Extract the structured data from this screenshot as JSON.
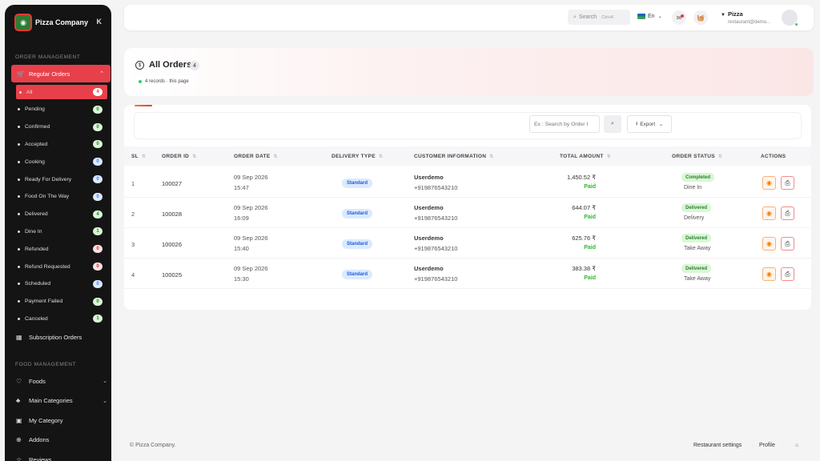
{
  "brand": {
    "name": "Pizza Company"
  },
  "sidebar": {
    "section_order": "ORDER MANAGEMENT",
    "regular_orders": "Regular Orders",
    "order_items": [
      {
        "label": "All",
        "count": "4",
        "color": "active"
      },
      {
        "label": "Pending",
        "count": "0",
        "color": "green"
      },
      {
        "label": "Confirmed",
        "count": "0",
        "color": "green"
      },
      {
        "label": "Accepted",
        "count": "0",
        "color": "green"
      },
      {
        "label": "Cooking",
        "count": "0",
        "color": "blue"
      },
      {
        "label": "Ready For Delivery",
        "count": "0",
        "color": "blue"
      },
      {
        "label": "Food On The Way",
        "count": "0",
        "color": "blue"
      },
      {
        "label": "Delivered",
        "count": "4",
        "color": "green"
      },
      {
        "label": "Dine In",
        "count": "1",
        "color": "green"
      },
      {
        "label": "Refunded",
        "count": "0",
        "color": "red"
      },
      {
        "label": "Refund Requested",
        "count": "0",
        "color": "red"
      },
      {
        "label": "Scheduled",
        "count": "0",
        "color": "blue"
      },
      {
        "label": "Payment Failed",
        "count": "0",
        "color": "green"
      },
      {
        "label": "Canceled",
        "count": "1",
        "color": "green"
      }
    ],
    "subscription_orders": "Subscription Orders",
    "section_food": "FOOD MANAGEMENT",
    "food_items": [
      {
        "label": "Foods",
        "icon": "heart-icon",
        "chevron": true
      },
      {
        "label": "Main Categories",
        "icon": "categories-icon",
        "chevron": true
      },
      {
        "label": "My Category",
        "icon": "category-icon",
        "chevron": false
      },
      {
        "label": "Addons",
        "icon": "addon-icon",
        "chevron": false
      },
      {
        "label": "Reviews",
        "icon": "star-icon",
        "chevron": false
      }
    ]
  },
  "topbar": {
    "search_label": "Search",
    "search_shortcut": "Ctrl+K",
    "language": "En",
    "user_name": "Pizza",
    "user_email": "restaurant@demo..."
  },
  "header": {
    "title": "All Orders",
    "count": "4",
    "records": "4 records · this page"
  },
  "toolbar": {
    "search_placeholder": "Ex : Search by Order I",
    "export_label": "Export"
  },
  "table": {
    "columns": [
      "SL",
      "ORDER ID",
      "ORDER DATE",
      "DELIVERY TYPE",
      "CUSTOMER INFORMATION",
      "TOTAL AMOUNT",
      "ORDER STATUS",
      "ACTIONS"
    ],
    "rows": [
      {
        "sl": "1",
        "order_id": "100027",
        "date": "09 Sep 2026",
        "time": "15:47",
        "delivery": "Standard",
        "customer": "Userdemo",
        "phone": "+919876543210",
        "amount": "1,450.52 ₹",
        "payment": "Paid",
        "status": "Completed",
        "order_type": "Dine In"
      },
      {
        "sl": "2",
        "order_id": "100028",
        "date": "09 Sep 2026",
        "time": "16:09",
        "delivery": "Standard",
        "customer": "Userdemo",
        "phone": "+919876543210",
        "amount": "644.07 ₹",
        "payment": "Paid",
        "status": "Delivered",
        "order_type": "Delivery"
      },
      {
        "sl": "3",
        "order_id": "100026",
        "date": "09 Sep 2026",
        "time": "15:40",
        "delivery": "Standard",
        "customer": "Userdemo",
        "phone": "+919876543210",
        "amount": "625.76 ₹",
        "payment": "Paid",
        "status": "Delivered",
        "order_type": "Take Away"
      },
      {
        "sl": "4",
        "order_id": "100025",
        "date": "09 Sep 2026",
        "time": "15:30",
        "delivery": "Standard",
        "customer": "Userdemo",
        "phone": "+919876543210",
        "amount": "383.38 ₹",
        "payment": "Paid",
        "status": "Delivered",
        "order_type": "Take Away"
      }
    ]
  },
  "footer": {
    "copyright": "© Pizza Company.",
    "restaurant_settings": "Restaurant settings",
    "profile": "Profile"
  },
  "colors": {
    "accent": "#e8404a",
    "sidebar_bg": "#141414",
    "paid": "#2eb82e",
    "standard_badge": "#dbeafe"
  }
}
